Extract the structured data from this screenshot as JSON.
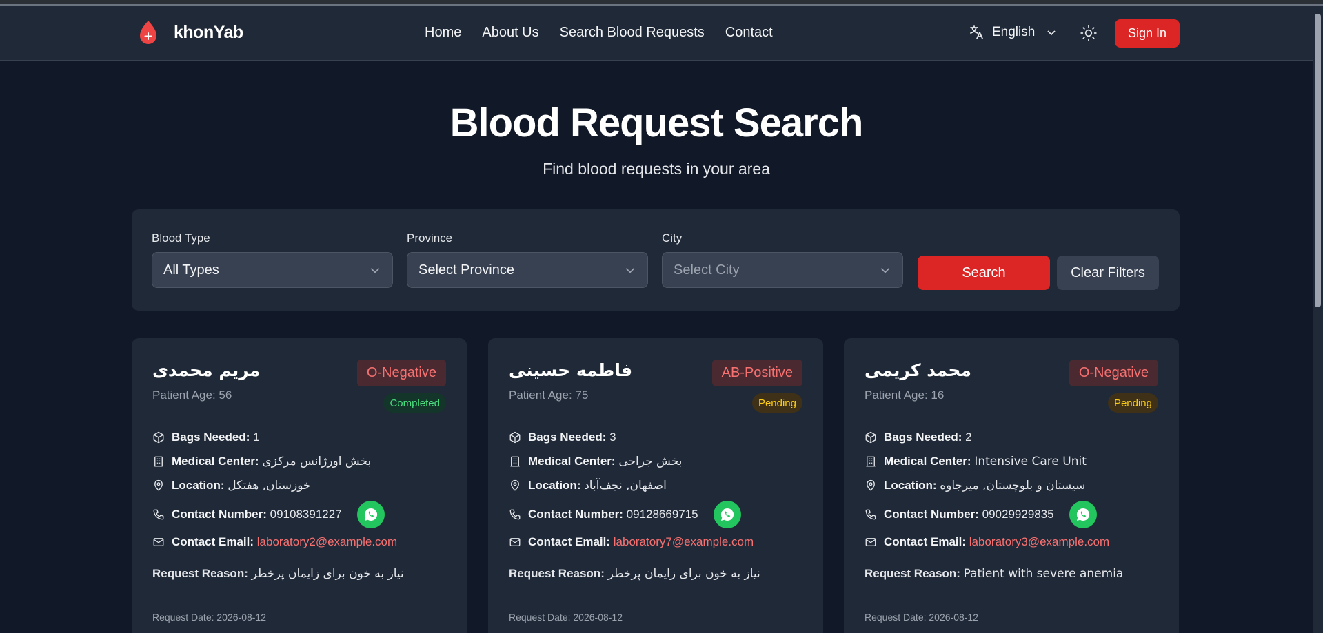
{
  "brand": {
    "name": "khonYab"
  },
  "nav": {
    "items": [
      "Home",
      "About Us",
      "Search Blood Requests",
      "Contact"
    ]
  },
  "language": {
    "selected": "English"
  },
  "auth": {
    "signin_label": "Sign In"
  },
  "hero": {
    "title": "Blood Request Search",
    "subtitle": "Find blood requests in your area"
  },
  "filters": {
    "blood_type": {
      "label": "Blood Type",
      "value": "All Types"
    },
    "province": {
      "label": "Province",
      "value": "Select Province"
    },
    "city": {
      "label": "City",
      "value": "Select City"
    },
    "search_label": "Search",
    "clear_label": "Clear Filters"
  },
  "labels": {
    "patient_age": "Patient Age:",
    "bags_needed": "Bags Needed:",
    "medical_center": "Medical Center:",
    "location": "Location:",
    "contact_number": "Contact Number:",
    "contact_email": "Contact Email:",
    "request_reason": "Request Reason:",
    "request_date": "Request Date:"
  },
  "cards": [
    {
      "name": "مریم محمدی",
      "age": "56",
      "blood_type": "O-Negative",
      "status": "Completed",
      "bags": "1",
      "medical_center": "بخش اورژانس مرکزی",
      "location": "خوزستان, هفتکل",
      "phone": "09108391227",
      "email": "laboratory2@example.com",
      "reason": "نیاز به خون برای زایمان پرخطر",
      "date": "2026-08-12"
    },
    {
      "name": "فاطمه حسینی",
      "age": "75",
      "blood_type": "AB-Positive",
      "status": "Pending",
      "bags": "3",
      "medical_center": "بخش جراحی",
      "location": "اصفهان, نجف‌آباد",
      "phone": "09128669715",
      "email": "laboratory7@example.com",
      "reason": "نیاز به خون برای زایمان پرخطر",
      "date": "2026-08-12"
    },
    {
      "name": "محمد کریمی",
      "age": "16",
      "blood_type": "O-Negative",
      "status": "Pending",
      "bags": "2",
      "medical_center": "Intensive Care Unit",
      "location": "سیستان و بلوچستان, میرجاوه",
      "phone": "09029929835",
      "email": "laboratory3@example.com",
      "reason": "Patient with severe anemia",
      "date": "2026-08-12"
    }
  ],
  "colors": {
    "accent": "#dc2626",
    "background": "#111827",
    "surface": "#1f2937",
    "whatsapp": "#22c55e"
  }
}
